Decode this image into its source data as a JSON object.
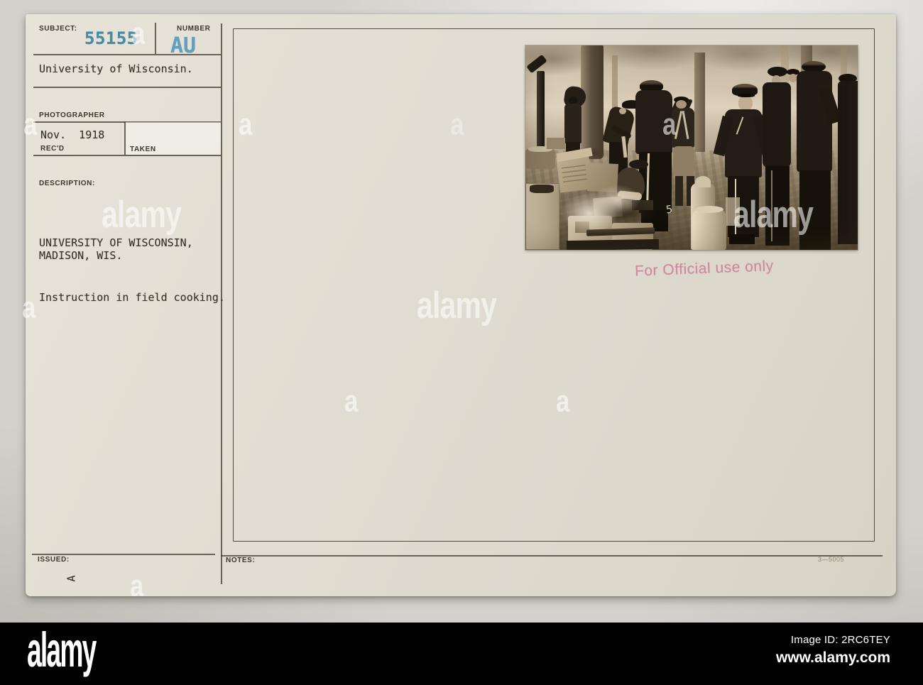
{
  "card": {
    "subject": {
      "label": "SUBJECT:",
      "value": "55155"
    },
    "number": {
      "label": "NUMBER",
      "value": "AU"
    },
    "org": "University of Wisconsin.",
    "photographer_label": "PHOTOGRAPHER",
    "date": "Nov.  1918",
    "recd_label": "REC'D",
    "taken_label": "TAKEN",
    "description": {
      "label": "DESCRIPTION:",
      "line1": "UNIVERSITY OF WISCONSIN,",
      "line2": "MADISON, WIS.",
      "line3": "Instruction in field cooking."
    },
    "issued": {
      "label": "ISSUED:",
      "mark": "A"
    },
    "notes": {
      "label": "NOTES:",
      "code": "3—5005"
    },
    "stamp": "For Official use only"
  },
  "photo": {
    "alt": "Sepia photograph of uniformed soldiers gathered among trees around a field kitchen with crates, pots and milk cans; instruction in field cooking, University of Wisconsin, Madison, Nov. 1918",
    "number_mark": "5"
  },
  "watermark": {
    "letter": "a",
    "word": "alamy"
  },
  "footer": {
    "brand": "alamy",
    "image_id": "Image ID: 2RC6TEY",
    "website": "www.alamy.com"
  },
  "colors": {
    "subject_blue": "#3e8ea9",
    "number_blue": "#5fa0c3",
    "stamp_pink": "#cb6a8c",
    "card_paper": "#e1ddd2",
    "footer_black": "#020202"
  }
}
